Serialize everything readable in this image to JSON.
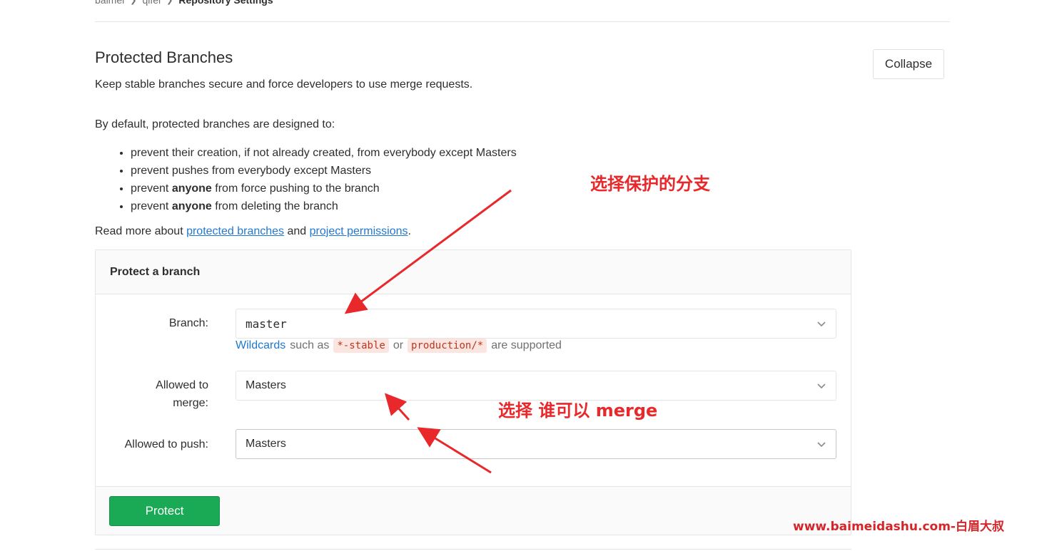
{
  "breadcrumb": {
    "items": [
      "baimei",
      "qifei",
      "Repository Settings"
    ]
  },
  "section": {
    "title": "Protected Branches",
    "description": "Keep stable branches secure and force developers to use merge requests.",
    "collapse_label": "Collapse",
    "default_intro": "By default, protected branches are designed to:",
    "bullets": {
      "b1": "prevent their creation, if not already created, from everybody except Masters",
      "b2": "prevent pushes from everybody except Masters",
      "b3_pre": "prevent ",
      "b3_bold": "anyone",
      "b3_post": " from force pushing to the branch",
      "b4_pre": "prevent ",
      "b4_bold": "anyone",
      "b4_post": " from deleting the branch"
    },
    "readmore": {
      "prefix": "Read more about ",
      "link1": "protected branches",
      "middle": " and ",
      "link2": "project permissions",
      "suffix": "."
    }
  },
  "form": {
    "panel_title": "Protect a branch",
    "branch_label": "Branch:",
    "branch_value": "master",
    "hint": {
      "link": "Wildcards",
      "t1": "such as",
      "code1": "*-stable",
      "t2": "or",
      "code2": "production/*",
      "t3": "are supported"
    },
    "merge_label_line1": "Allowed to",
    "merge_label_line2": "merge:",
    "merge_value": "Masters",
    "push_label": "Allowed to push:",
    "push_value": "Masters",
    "protect_label": "Protect"
  },
  "annotations": {
    "select_branch": "选择保护的分支",
    "select_merge": "选择 谁可以 merge",
    "watermark": "www.baimeidashu.com-白眉大叔"
  },
  "colors": {
    "link": "#1f78d1",
    "protect_button": "#1aaa55",
    "annotation": "#e8282b"
  },
  "icons": {
    "select_arrow": "chevron-down-icon",
    "breadcrumb_separator": "chevron-right-icon"
  }
}
